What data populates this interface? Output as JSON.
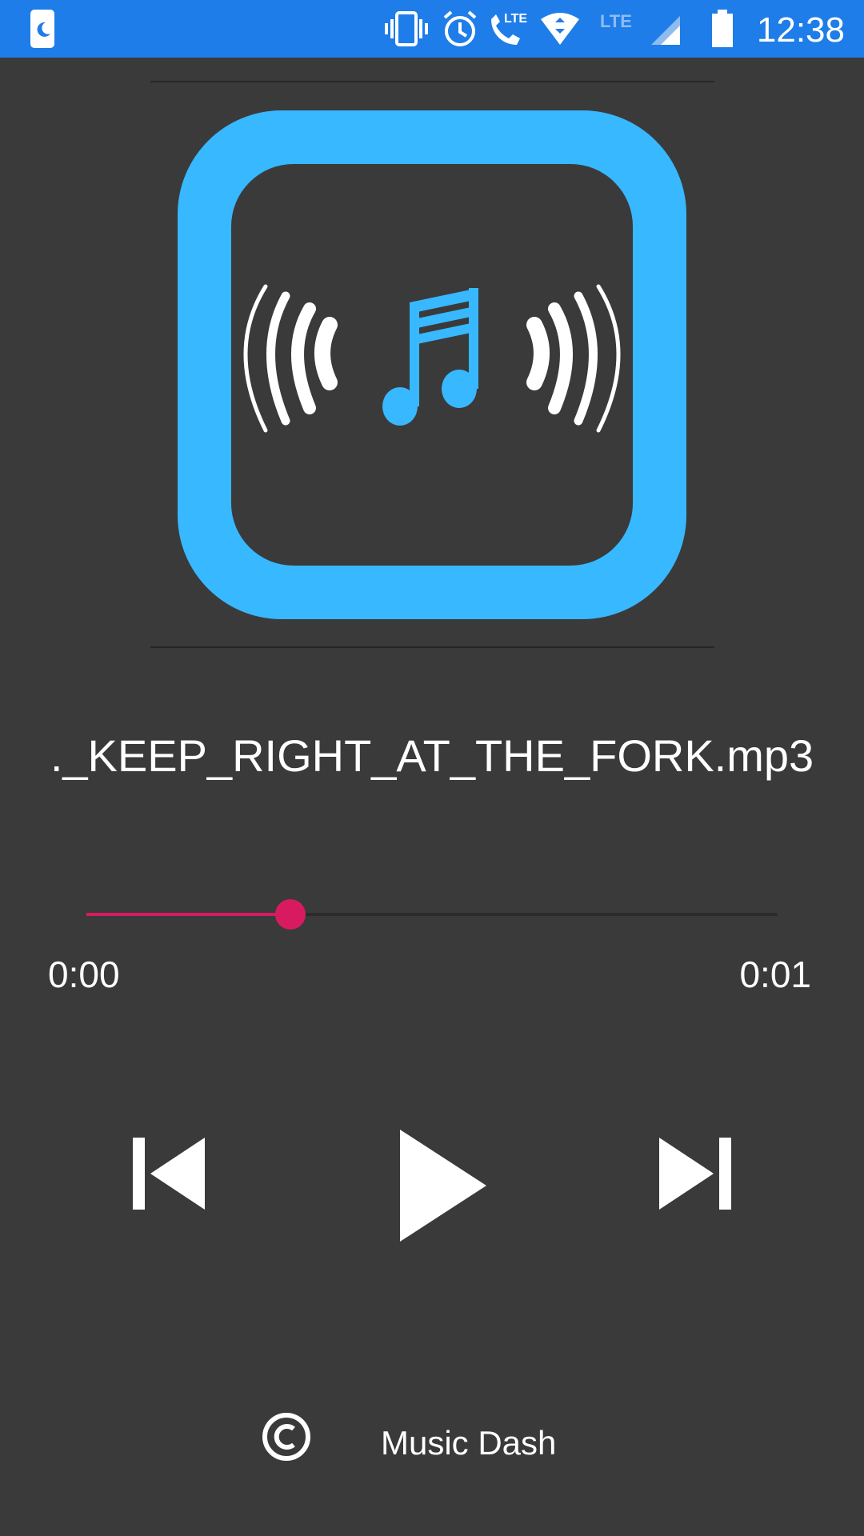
{
  "status_bar": {
    "time": "12:38",
    "background_color": "#1e7de8",
    "icons": [
      "moon-notification-icon",
      "vibrate-icon",
      "alarm-icon",
      "lte-call-icon",
      "wifi-icon",
      "lte-label-icon",
      "signal-icon",
      "battery-icon"
    ],
    "lte_call_label": "LTE",
    "lte_label": "LTE"
  },
  "album_art": {
    "icon": "music-broadcast-logo-icon",
    "accent_color": "#38b8fe"
  },
  "track": {
    "title": "._KEEP_RIGHT_AT_THE_FORK.mp3"
  },
  "seek": {
    "progress_fraction": 0.295,
    "accent_color": "#d81b60",
    "elapsed": "0:00",
    "total": "0:01"
  },
  "controls": {
    "previous_icon": "skip-previous-icon",
    "play_icon": "play-icon",
    "next_icon": "skip-next-icon"
  },
  "footer": {
    "copyright_icon": "copyright-icon",
    "label": "Music Dash"
  }
}
